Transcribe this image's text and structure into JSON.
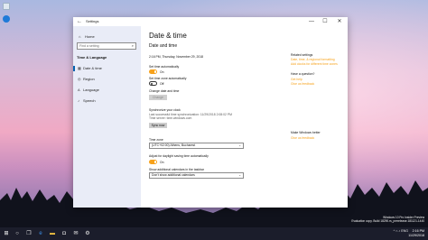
{
  "window": {
    "title": "Settings",
    "controls": {
      "minimize": "—",
      "maximize": "☐",
      "close": "✕"
    }
  },
  "sidebar": {
    "home_label": "Home",
    "search_placeholder": "Find a setting",
    "section_title": "Time & Language",
    "items": [
      {
        "label": "Date & time",
        "icon": "calendar-icon",
        "active": true
      },
      {
        "label": "Region",
        "icon": "globe-icon",
        "active": false
      },
      {
        "label": "Language",
        "icon": "language-icon",
        "active": false
      },
      {
        "label": "Speech",
        "icon": "microphone-icon",
        "active": false
      }
    ]
  },
  "main": {
    "title": "Date & time",
    "subtitle": "Date and time",
    "current_datetime": "2:16 PM, Thursday, November 29, 2018",
    "set_time_auto": {
      "label": "Set time automatically",
      "state": "On"
    },
    "set_zone_auto": {
      "label": "Set time zone automatically",
      "state": "Off"
    },
    "change_label": "Change date and time",
    "change_button": "Change",
    "sync": {
      "title": "Synchronize your clock",
      "last_sync": "Last successful time synchronization: 11/29/2018 2:08:02 PM",
      "server": "Time server: time.windows.com",
      "button": "Sync now"
    },
    "timezone": {
      "label": "Time zone",
      "value": "(UTC+02:00) Athens, Bucharest"
    },
    "dst": {
      "label": "Adjust for daylight saving time automatically",
      "state": "On"
    },
    "calendars": {
      "label": "Show additional calendars in the taskbar",
      "value": "Don't show additional calendars"
    }
  },
  "related": {
    "heading": "Related settings",
    "links": [
      "Date, time, & regional formatting",
      "Add clocks for different time zones"
    ],
    "question_heading": "Have a question?",
    "question_links": [
      "Get help",
      "Give us feedback"
    ],
    "better_heading": "Make Windows better",
    "better_link": "Give us feedback"
  },
  "taskbar": {
    "tray": "^ ⌂ ♪ ENG",
    "time": "2:16 PM",
    "date": "11/29/2018"
  },
  "watermark": {
    "line1": "Windows 10 Pro Insider Preview",
    "line2": "Evaluation copy. Build 18290.rs_prerelease.181121-1440"
  }
}
